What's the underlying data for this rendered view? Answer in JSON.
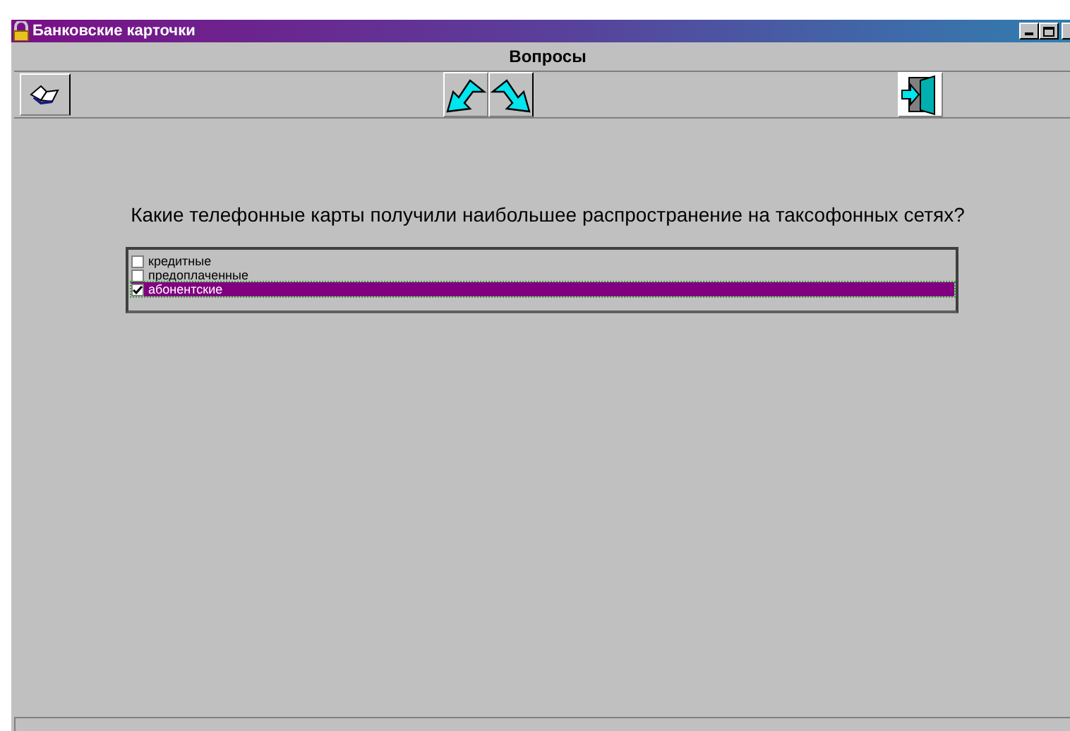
{
  "window": {
    "title": "Банковские карточки"
  },
  "header": {
    "title": "Вопросы"
  },
  "question": "Какие телефонные карты получили наибольшее распространение на таксофонных сетях?",
  "answers": [
    {
      "label": "кредитные",
      "checked": false,
      "selected": false
    },
    {
      "label": "предоплаченные",
      "checked": false,
      "selected": false
    },
    {
      "label": "абонентские",
      "checked": true,
      "selected": true
    }
  ]
}
